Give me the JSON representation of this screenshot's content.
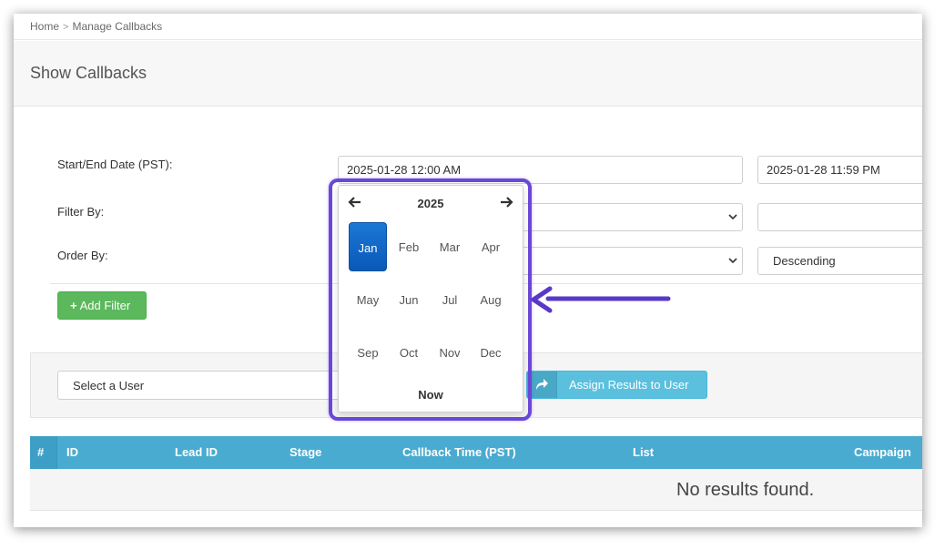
{
  "breadcrumb": {
    "home": "Home",
    "separator": ">",
    "current": "Manage Callbacks"
  },
  "page": {
    "title": "Show Callbacks"
  },
  "form": {
    "date_label": "Start/End Date (PST):",
    "start_date": "2025-01-28 12:00 AM",
    "end_date": "2025-01-28 11:59 PM",
    "filter_label": "Filter By:",
    "filter_value": "",
    "filter_text": "",
    "order_label": "Order By:",
    "order_field": "",
    "order_direction": "Descending"
  },
  "buttons": {
    "add_filter": "Add Filter",
    "add_filter_icon": "+",
    "assign": "Assign Results to User"
  },
  "assign": {
    "user_select": "Select a User"
  },
  "table": {
    "columns": [
      "#",
      "ID",
      "Lead ID",
      "Stage",
      "Callback Time (PST)",
      "List",
      "Campaign"
    ],
    "empty_message": "No results found."
  },
  "date_picker": {
    "year": "2025",
    "months": [
      "Jan",
      "Feb",
      "Mar",
      "Apr",
      "May",
      "Jun",
      "Jul",
      "Aug",
      "Sep",
      "Oct",
      "Nov",
      "Dec"
    ],
    "selected_month": "Jan",
    "now_label": "Now"
  },
  "colors": {
    "callout": "#6a47d6",
    "add_button": "#5cb85c",
    "assign_button": "#5bc0de",
    "table_header": "#4aabd0",
    "selected_month": "#0d63c6"
  },
  "icons": [
    "chevron-right-icon",
    "caret-down-icon",
    "plus-icon",
    "share-arrow-icon",
    "arrow-left-icon",
    "arrow-right-icon"
  ]
}
